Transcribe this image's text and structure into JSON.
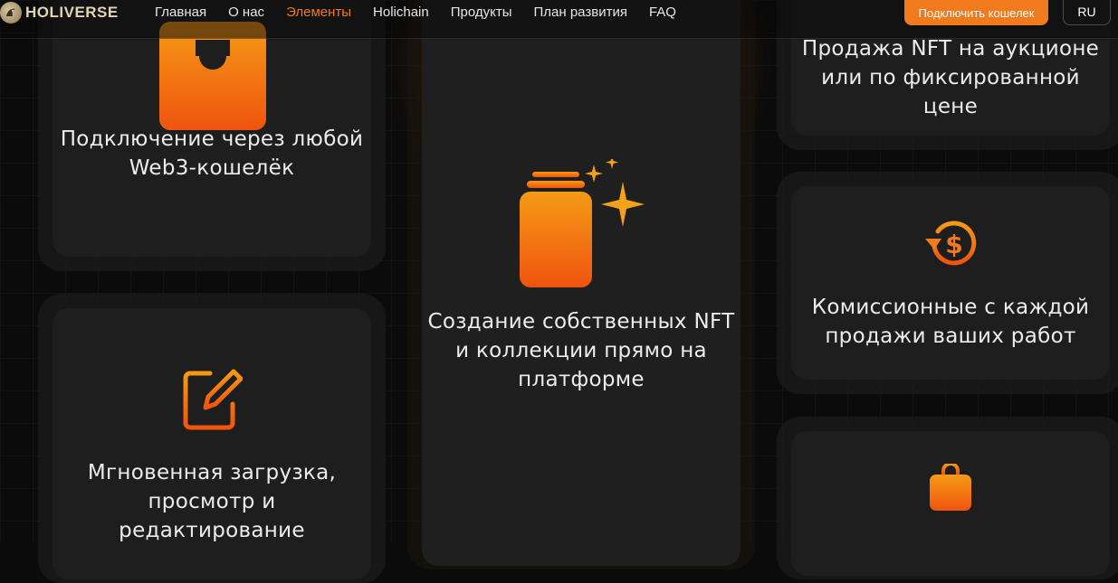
{
  "brand": {
    "name": "HOLIVERSE"
  },
  "nav": {
    "items": [
      {
        "label": "Главная"
      },
      {
        "label": "О нас"
      },
      {
        "label": "Элементы"
      },
      {
        "label": "Holichain"
      },
      {
        "label": "Продукты"
      },
      {
        "label": "План развития"
      },
      {
        "label": "FAQ"
      }
    ],
    "active_index": 2
  },
  "header": {
    "connect_label": "Подключить кошелек",
    "lang_label": "RU"
  },
  "features": {
    "wallet": "Подключение через любой Web3-кошелёк",
    "create_nft": "Создание собственных NFT и коллекции прямо на платформе",
    "sale": "Продажа NFT на аукционе или по фиксированной цене",
    "commission": "Комиссионные с каждой продажи ваших работ",
    "upload": "Мгновенная загрузка, просмотр и редактирование"
  },
  "icons": {
    "wallet": "wallet-icon",
    "create_nft": "stack-sparkle-icon",
    "commission": "dollar-refresh-icon",
    "upload": "edit-icon",
    "bag": "bag-icon"
  },
  "colors": {
    "accent": "#f07a1c",
    "accent_gradient_top": "#f59a16",
    "accent_gradient_bottom": "#f0540f",
    "card_bg": "#1e1e1e",
    "page_bg": "#0b0b0b"
  }
}
